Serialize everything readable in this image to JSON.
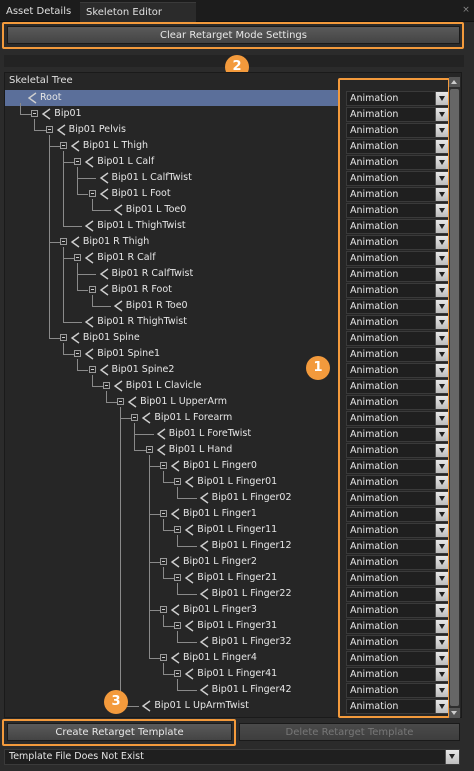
{
  "tabs": [
    {
      "label": "Asset Details"
    },
    {
      "label": "Skeleton Editor"
    }
  ],
  "tab_close": "×",
  "clear_button": "Clear Retarget Mode Settings",
  "badges": {
    "one": "1",
    "two": "2",
    "three": "3"
  },
  "tree_header": "Skeletal Tree",
  "retarget_option": "Animation",
  "accent_color": "#f39a3c",
  "bones": [
    {
      "name": "Root",
      "depth": 0,
      "expandable": false,
      "selected": true
    },
    {
      "name": "Bip01",
      "depth": 1,
      "expandable": true
    },
    {
      "name": "Bip01 Pelvis",
      "depth": 2,
      "expandable": true
    },
    {
      "name": "Bip01 L Thigh",
      "depth": 3,
      "expandable": true
    },
    {
      "name": "Bip01 L Calf",
      "depth": 4,
      "expandable": true
    },
    {
      "name": "Bip01 L CalfTwist",
      "depth": 5,
      "expandable": false
    },
    {
      "name": "Bip01 L Foot",
      "depth": 5,
      "expandable": true
    },
    {
      "name": "Bip01 L Toe0",
      "depth": 6,
      "expandable": false
    },
    {
      "name": "Bip01 L ThighTwist",
      "depth": 4,
      "expandable": false
    },
    {
      "name": "Bip01 R Thigh",
      "depth": 3,
      "expandable": true
    },
    {
      "name": "Bip01 R Calf",
      "depth": 4,
      "expandable": true
    },
    {
      "name": "Bip01 R CalfTwist",
      "depth": 5,
      "expandable": false
    },
    {
      "name": "Bip01 R Foot",
      "depth": 5,
      "expandable": true
    },
    {
      "name": "Bip01 R Toe0",
      "depth": 6,
      "expandable": false
    },
    {
      "name": "Bip01 R ThighTwist",
      "depth": 4,
      "expandable": false
    },
    {
      "name": "Bip01 Spine",
      "depth": 3,
      "expandable": true
    },
    {
      "name": "Bip01 Spine1",
      "depth": 4,
      "expandable": true
    },
    {
      "name": "Bip01 Spine2",
      "depth": 5,
      "expandable": true
    },
    {
      "name": "Bip01 L Clavicle",
      "depth": 6,
      "expandable": true
    },
    {
      "name": "Bip01 L UpperArm",
      "depth": 7,
      "expandable": true
    },
    {
      "name": "Bip01 L Forearm",
      "depth": 8,
      "expandable": true
    },
    {
      "name": "Bip01 L ForeTwist",
      "depth": 9,
      "expandable": false
    },
    {
      "name": "Bip01 L Hand",
      "depth": 9,
      "expandable": true
    },
    {
      "name": "Bip01 L Finger0",
      "depth": 10,
      "expandable": true
    },
    {
      "name": "Bip01 L Finger01",
      "depth": 11,
      "expandable": true
    },
    {
      "name": "Bip01 L Finger02",
      "depth": 12,
      "expandable": false
    },
    {
      "name": "Bip01 L Finger1",
      "depth": 10,
      "expandable": true
    },
    {
      "name": "Bip01 L Finger11",
      "depth": 11,
      "expandable": true
    },
    {
      "name": "Bip01 L Finger12",
      "depth": 12,
      "expandable": false
    },
    {
      "name": "Bip01 L Finger2",
      "depth": 10,
      "expandable": true
    },
    {
      "name": "Bip01 L Finger21",
      "depth": 11,
      "expandable": true
    },
    {
      "name": "Bip01 L Finger22",
      "depth": 12,
      "expandable": false
    },
    {
      "name": "Bip01 L Finger3",
      "depth": 10,
      "expandable": true
    },
    {
      "name": "Bip01 L Finger31",
      "depth": 11,
      "expandable": true
    },
    {
      "name": "Bip01 L Finger32",
      "depth": 12,
      "expandable": false
    },
    {
      "name": "Bip01 L Finger4",
      "depth": 10,
      "expandable": true
    },
    {
      "name": "Bip01 L Finger41",
      "depth": 11,
      "expandable": true
    },
    {
      "name": "Bip01 L Finger42",
      "depth": 12,
      "expandable": false
    },
    {
      "name": "Bip01 L UpArmTwist",
      "depth": 8,
      "expandable": false
    }
  ],
  "create_button": "Create Retarget Template",
  "delete_button": "Delete Retarget Template",
  "template_status": "Template File Does Not Exist"
}
